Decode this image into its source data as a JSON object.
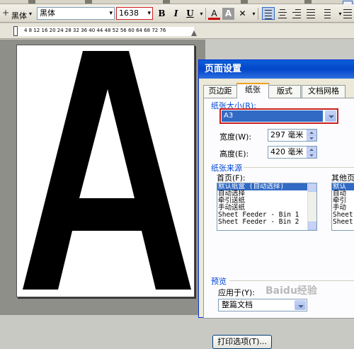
{
  "toolbar": {
    "style_label": "黑体",
    "font_name": "黑体",
    "font_size": "1638",
    "bold": "B",
    "italic": "I",
    "underline": "U",
    "font_color": "A",
    "char_shading": "A"
  },
  "ruler": {
    "numbers": "4  8  12  16  20  24  28  32  36  40  44  48  52  56  60  64  68  72  76"
  },
  "document": {
    "big_letter": "A"
  },
  "dialog": {
    "title": "页面设置",
    "tabs": [
      {
        "label": "页边距"
      },
      {
        "label": "纸张"
      },
      {
        "label": "版式"
      },
      {
        "label": "文档网格"
      }
    ],
    "paper_size_label": "纸张大小(R):",
    "paper_size_value": "A3",
    "width_label": "宽度(W):",
    "width_value": "297 毫米",
    "height_label": "高度(E):",
    "height_value": "420 毫米",
    "paper_source_label": "纸张来源",
    "first_page_label": "首页(F):",
    "other_pages_label": "其他页",
    "first_page_items": [
      "默认纸盒 (自动选择)",
      "自动选择",
      "牵引送纸",
      "手动送纸",
      "Sheet Feeder - Bin 1",
      "Sheet Feeder - Bin 2"
    ],
    "other_page_items": [
      "默认",
      "自动",
      "牵引",
      "手动",
      "Sheet",
      "Sheet"
    ],
    "preview_label": "预览",
    "apply_to_label": "应用于(Y):",
    "apply_to_value": "整篇文档",
    "print_options_button": "打印选项(T)..."
  },
  "watermark": "Baidu经验"
}
